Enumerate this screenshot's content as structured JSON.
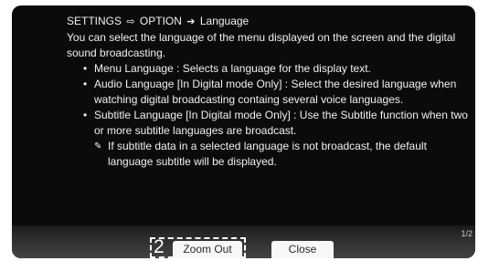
{
  "breadcrumb": {
    "settings": "SETTINGS",
    "sep1": "⇨",
    "option": "OPTION",
    "sep2": "➔",
    "current": "Language"
  },
  "intro": "You can select the language of the menu displayed on the screen and the digital sound broadcasting.",
  "bullets": [
    "Menu Language : Selects a language for the display text.",
    "Audio Language [In Digital mode Only] : Select the desired language when watching digital broadcasting containg several voice languages.",
    "Subtitle Language [In Digital mode Only] : Use the Subtitle function when two or more subtitle languages are broadcast."
  ],
  "note": {
    "icon": "note-pencil-icon",
    "glyph": "✎",
    "text": "If subtitle data in a selected language is not broadcast, the default language subtitle will be displayed."
  },
  "footer": {
    "page_indicator": "1/2",
    "key_number": "2",
    "zoom_out_label": "Zoom Out",
    "close_label": "Close"
  }
}
